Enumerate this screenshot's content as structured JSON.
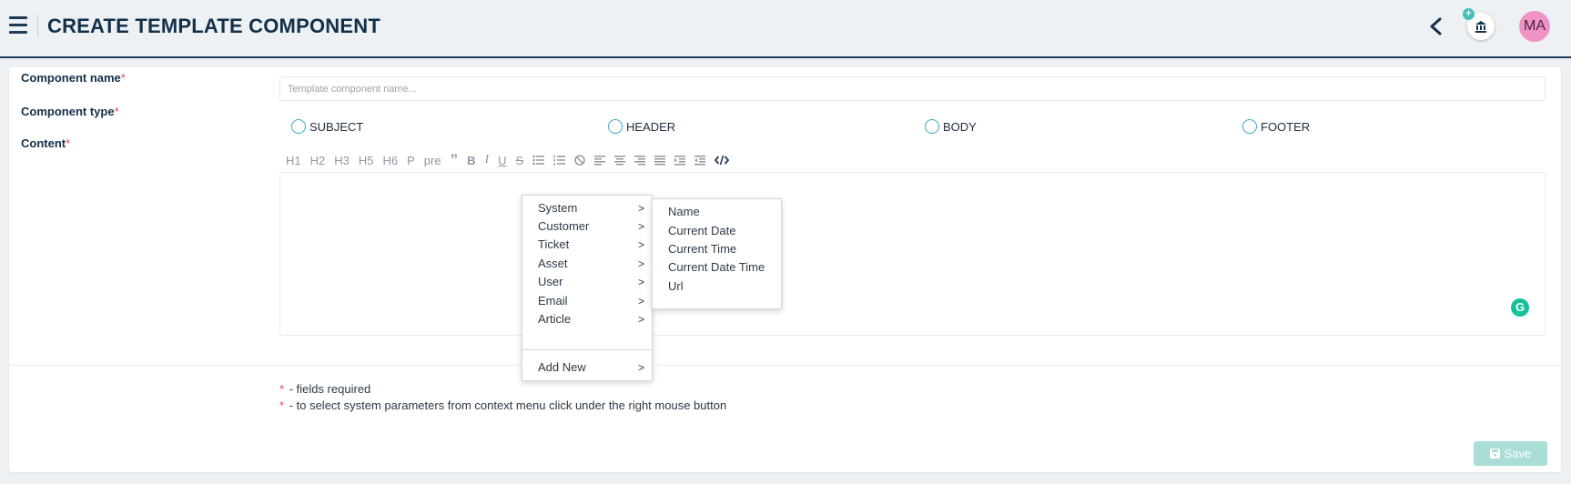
{
  "header": {
    "title": "CREATE TEMPLATE COMPONENT",
    "avatar_initials": "MA",
    "accent_color": "#1d3b57"
  },
  "form": {
    "name_label": "Component name",
    "type_label": "Component type",
    "content_label": "Content",
    "required_mark": "*",
    "name_placeholder": "Template component name...",
    "name_value": "",
    "types": [
      "SUBJECT",
      "HEADER",
      "BODY",
      "FOOTER"
    ],
    "toolbar": {
      "h1": "H1",
      "h2": "H2",
      "h3": "H3",
      "h5": "H5",
      "h6": "H6",
      "p": "P",
      "pre": "pre",
      "quote": "”",
      "bold": "B",
      "italic": "I",
      "underline": "U",
      "strike": "S"
    }
  },
  "context_menu": {
    "items": [
      "System",
      "Customer",
      "Ticket",
      "Asset",
      "User",
      "Email",
      "Article"
    ],
    "add_new": "Add New",
    "arrow": ">",
    "submenu": [
      "Name",
      "Current Date",
      "Current Time",
      "Current Date Time",
      "Url"
    ]
  },
  "notes": {
    "mark": "*",
    "required": "- fields required",
    "context_hint": "- to select system parameters from context menu click under the right mouse button"
  },
  "actions": {
    "save_label": "Save"
  },
  "grammarly_glyph": "G",
  "bank_plus_glyph": "+"
}
